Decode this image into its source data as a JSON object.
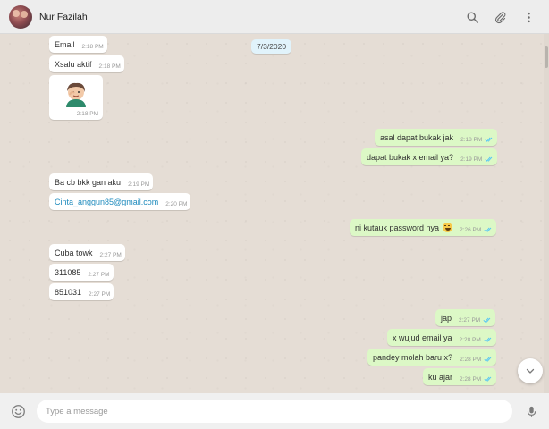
{
  "header": {
    "contact_name": "Nur Fazilah",
    "icons": [
      "search-icon",
      "attach-icon",
      "menu-icon"
    ]
  },
  "chat": {
    "date_chip": "7/3/2020",
    "messages": [
      {
        "dir": "in",
        "text": "Email",
        "time": "2:18 PM"
      },
      {
        "dir": "in",
        "text": "Xsalu aktif",
        "time": "2:18 PM"
      },
      {
        "dir": "in",
        "sticker": true,
        "time": "2:18 PM"
      },
      {
        "dir": "out",
        "text": "asal dapat bukak jak",
        "time": "2:18 PM"
      },
      {
        "dir": "out",
        "text": "dapat bukak x email ya?",
        "time": "2:19 PM"
      },
      {
        "dir": "in",
        "text": "Ba cb bkk gan aku",
        "time": "2:19 PM"
      },
      {
        "dir": "in",
        "text": "Cinta_anggun85@gmail.com",
        "time": "2:20 PM",
        "link": true
      },
      {
        "dir": "out",
        "text": "ni kutauk password nya",
        "emoji": "grinning-sweat-emoji",
        "time": "2:26 PM"
      },
      {
        "dir": "in",
        "text": "Cuba towk",
        "time": "2:27 PM"
      },
      {
        "dir": "in",
        "text": "311085",
        "time": "2:27 PM"
      },
      {
        "dir": "in",
        "text": "851031",
        "time": "2:27 PM"
      },
      {
        "dir": "out",
        "text": "jap",
        "time": "2:27 PM"
      },
      {
        "dir": "out",
        "text": "x wujud email ya",
        "time": "2:28 PM"
      },
      {
        "dir": "out",
        "text": "pandey molah baru x?",
        "time": "2:28 PM"
      },
      {
        "dir": "out",
        "text": "ku ajar",
        "time": "2:28 PM"
      }
    ]
  },
  "footer": {
    "input_placeholder": "Type a message",
    "icons": [
      "emoji-icon",
      "mic-icon"
    ]
  },
  "colors": {
    "incoming_bubble": "#ffffff",
    "outgoing_bubble": "#dcf8c6",
    "chat_background": "#e5ddd5",
    "read_ticks": "#4fc3f7",
    "link": "#1f8bbd",
    "header_background": "#ededed"
  }
}
